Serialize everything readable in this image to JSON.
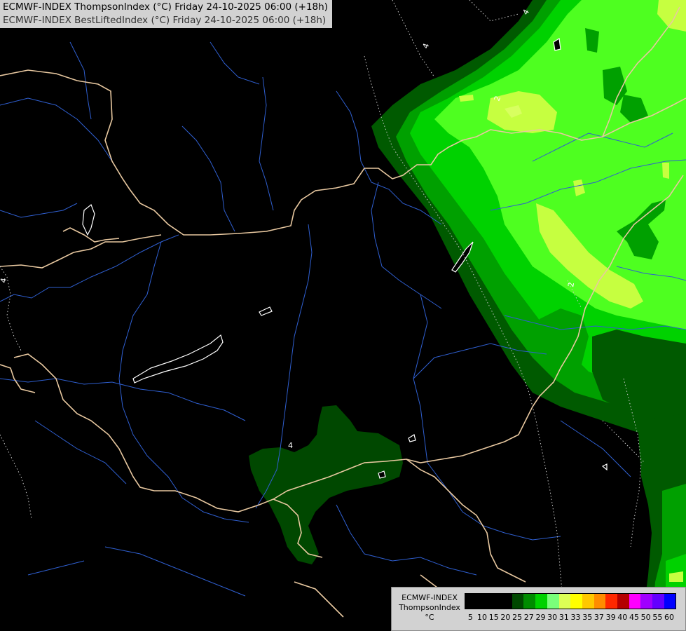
{
  "title": {
    "line1": "ECMWF-INDEX ThompsonIndex (°C) Friday 24-10-2025 06:00 (+18h)",
    "line2": "ECMWF-INDEX BestLiftedIndex (°C) Friday 24-10-2025 06:00 (+18h)"
  },
  "legend": {
    "model": "ECMWF-INDEX",
    "parameter": "ThompsonIndex",
    "unit": "°C",
    "classes": [
      {
        "value": "5",
        "color": "#000000"
      },
      {
        "value": "10",
        "color": "#000000"
      },
      {
        "value": "15",
        "color": "#000000"
      },
      {
        "value": "20",
        "color": "#000000"
      },
      {
        "value": "25",
        "color": "#004800"
      },
      {
        "value": "27",
        "color": "#008c00"
      },
      {
        "value": "29",
        "color": "#00d200"
      },
      {
        "value": "30",
        "color": "#7aff7a"
      },
      {
        "value": "31",
        "color": "#dcff55"
      },
      {
        "value": "33",
        "color": "#ffff00"
      },
      {
        "value": "35",
        "color": "#ffc800"
      },
      {
        "value": "37",
        "color": "#ff8c00"
      },
      {
        "value": "39",
        "color": "#ff2800"
      },
      {
        "value": "40",
        "color": "#b40000"
      },
      {
        "value": "45",
        "color": "#ff00ff"
      },
      {
        "value": "50",
        "color": "#a000ff"
      },
      {
        "value": "55",
        "color": "#6400ff"
      },
      {
        "value": "60",
        "color": "#0000ff"
      }
    ]
  },
  "contour_labels": [
    "4",
    "4",
    "4",
    "2",
    "2",
    "4"
  ]
}
